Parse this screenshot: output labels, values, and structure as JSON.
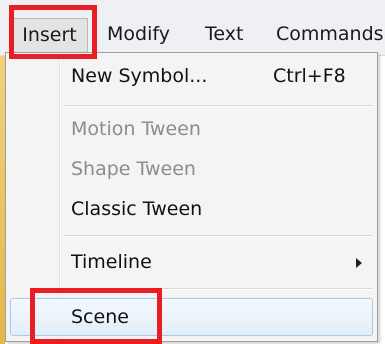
{
  "menubar": {
    "items": [
      "Insert",
      "Modify",
      "Text",
      "Commands"
    ]
  },
  "dropdown": {
    "items": [
      {
        "label": "New Symbol...",
        "shortcut": "Ctrl+F8"
      },
      {
        "label": "Motion Tween"
      },
      {
        "label": "Shape Tween"
      },
      {
        "label": "Classic Tween"
      },
      {
        "label": "Timeline"
      },
      {
        "label": "Scene"
      }
    ]
  },
  "colors": {
    "highlight_border": "#ea1c24",
    "menu_bg": "#f4f4f4",
    "disabled_text": "#8c8c8c",
    "hover_bg": "#e3eef9"
  }
}
